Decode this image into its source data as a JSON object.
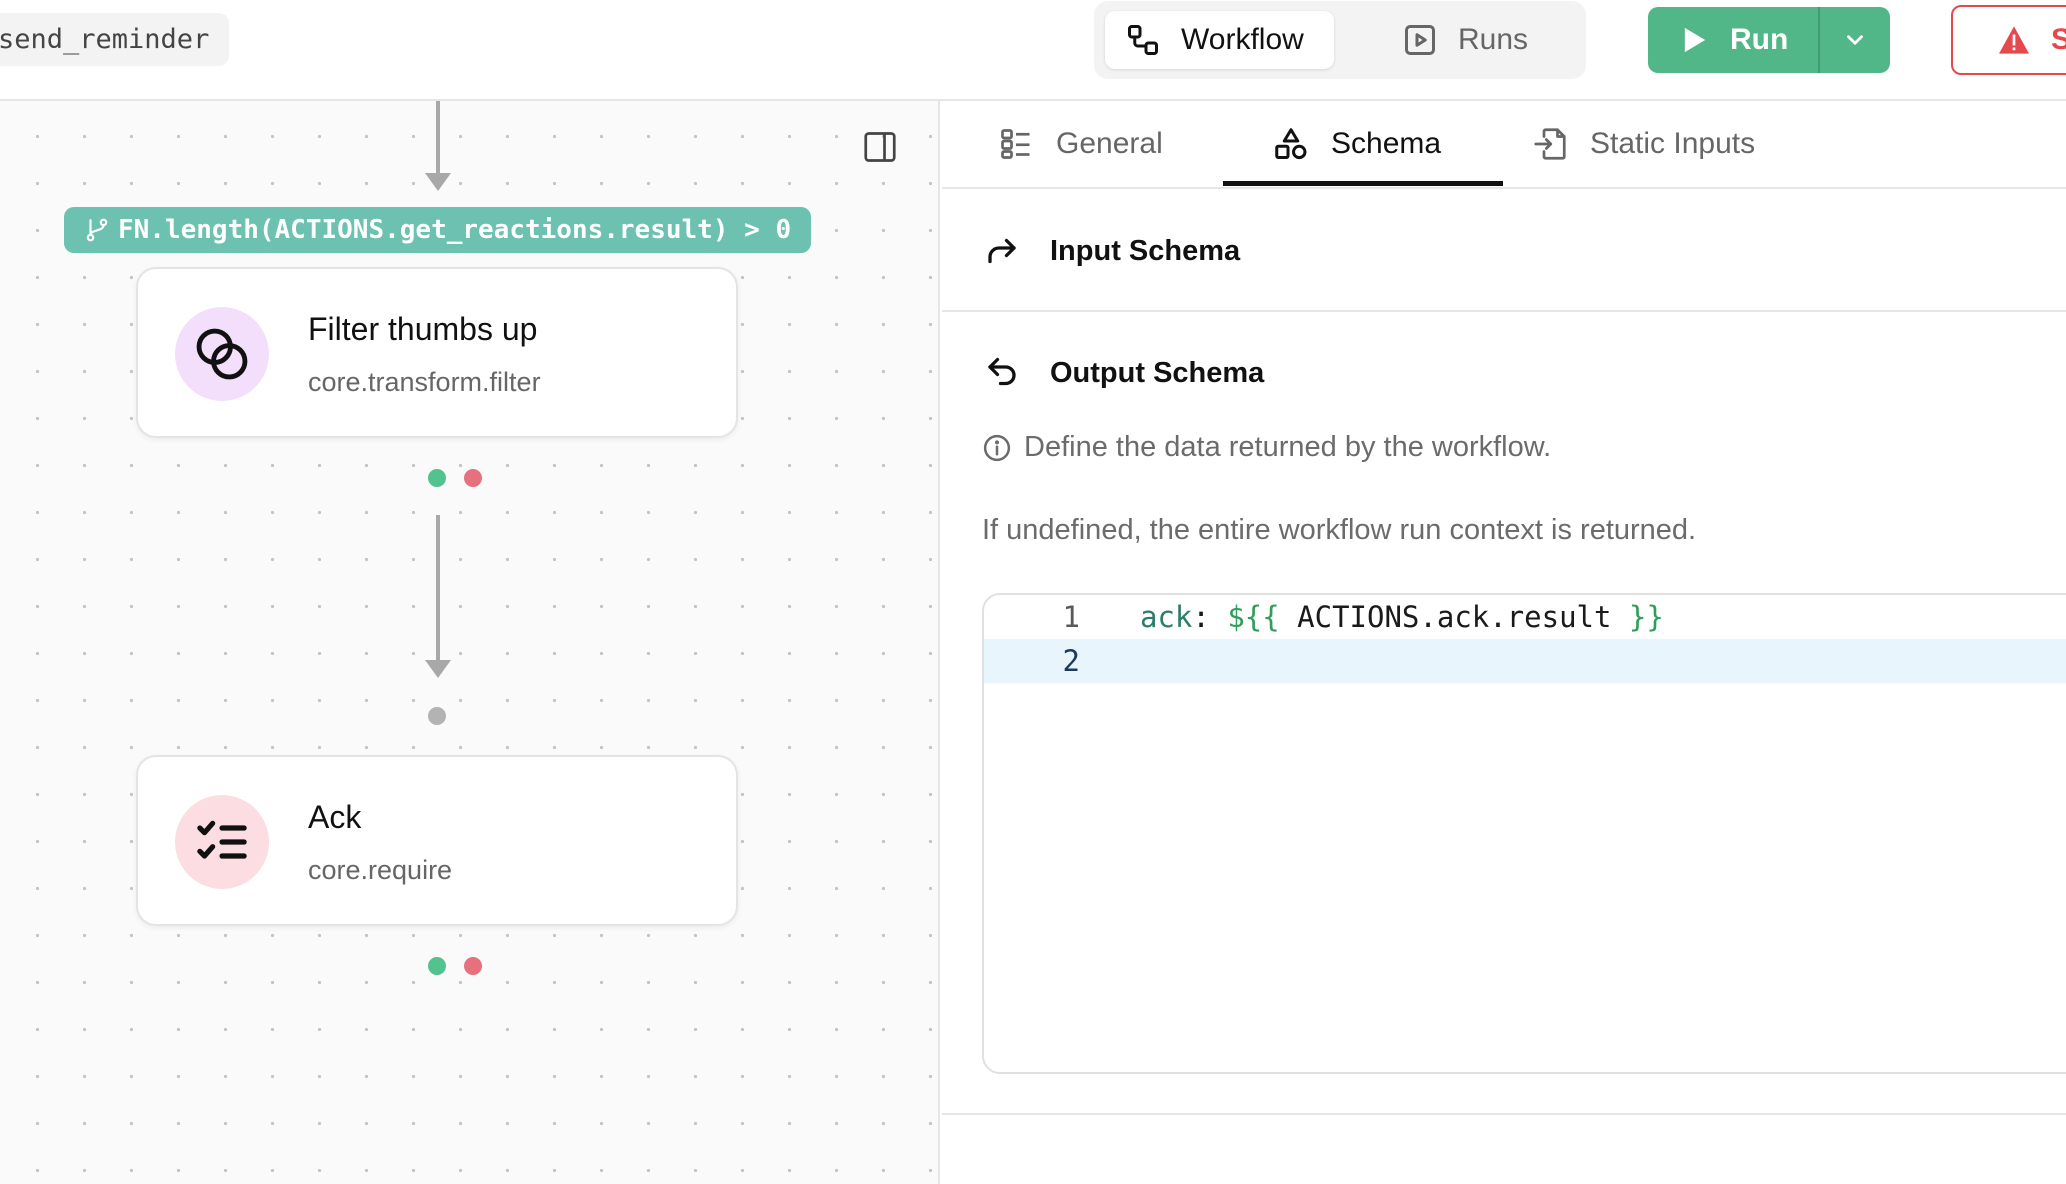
{
  "header": {
    "workflow_name": "send_reminder",
    "views": [
      {
        "label": "Workflow",
        "icon": "workflow-icon",
        "active": true
      },
      {
        "label": "Runs",
        "icon": "play-square-icon",
        "active": false
      }
    ],
    "run_label": "Run",
    "alert_label": "S"
  },
  "canvas": {
    "condition": "FN.length(ACTIONS.get_reactions.result) > 0",
    "nodes": [
      {
        "title": "Filter thumbs up",
        "subtitle": "core.transform.filter",
        "icon": "intersect-circles-icon",
        "icon_bg": "#f3dffb"
      },
      {
        "title": "Ack",
        "subtitle": "core.require",
        "icon": "checklist-icon",
        "icon_bg": "#fbdde2"
      }
    ]
  },
  "panel": {
    "tabs": [
      {
        "label": "General",
        "icon": "list-layout-icon"
      },
      {
        "label": "Schema",
        "icon": "shapes-icon"
      },
      {
        "label": "Static Inputs",
        "icon": "file-import-icon"
      }
    ],
    "active_tab": "Schema",
    "input_schema_title": "Input Schema",
    "output_schema_title": "Output Schema",
    "output_info": "Define the data returned by the workflow.",
    "output_note": "If undefined, the entire workflow run context is returned.",
    "editor": {
      "lines": [
        {
          "number": "1",
          "key": "ack",
          "colon": ":",
          "open": "${{",
          "expr": " ACTIONS.ack.result ",
          "close": "}}"
        },
        {
          "number": "2"
        }
      ]
    }
  },
  "colors": {
    "run_green": "#52b788",
    "condition_teal": "#6cc1b0",
    "success_dot": "#52c28f",
    "error_dot": "#e5707e",
    "alert_red": "#e5484d"
  }
}
